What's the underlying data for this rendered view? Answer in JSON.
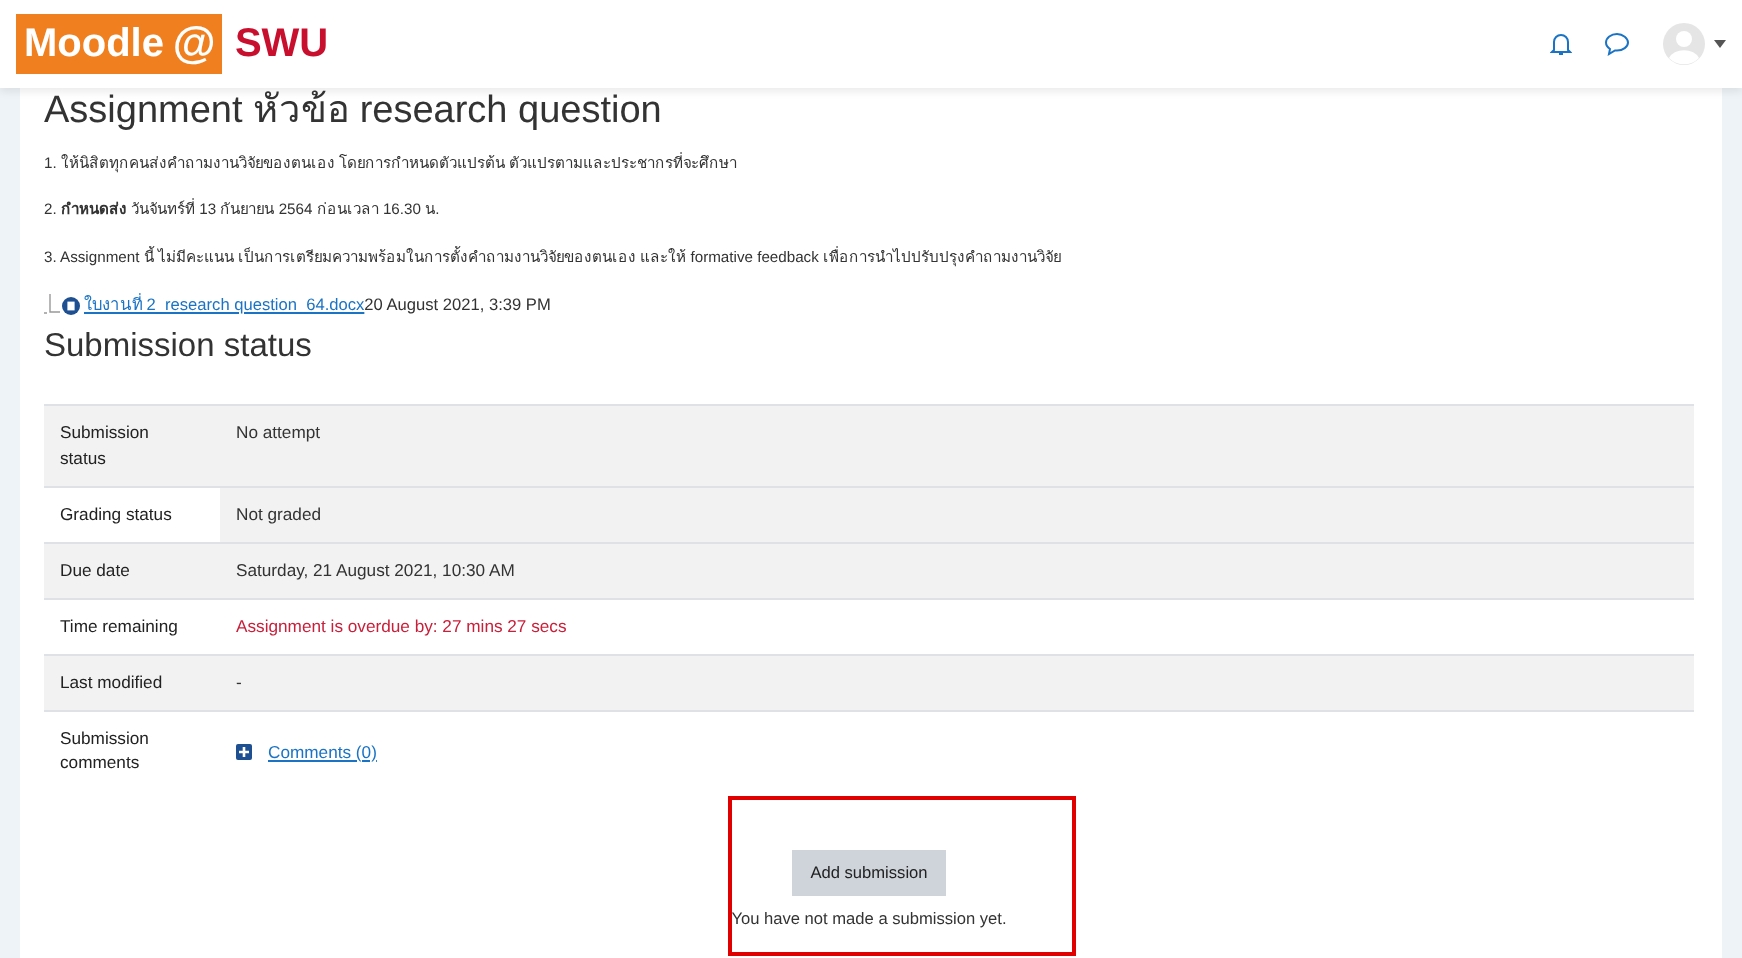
{
  "navbar": {
    "logo_left": "Moodle",
    "logo_at": "@",
    "logo_right": "SWU"
  },
  "title": "Assignment หัวข้อ research question",
  "instructions": [
    "1. ให้นิสิตทุกคนส่งคำถามงานวิจัยของตนเอง โดยการกำหนดตัวแปรต้น ตัวแปรตามและประชากรที่จะศึกษา",
    "2. **กำหนดส่ง** วันจันทร์ที่ 13 กันยายน 2564 ก่อนเวลา 16.30 น.",
    "3. Assignment นี้ ไม่มีคะแนน เป็นการเตรียมความพร้อมในการตั้งคำถามงานวิจัยของตนเอง และให้ formative feedback เพื่อการนำไปปรับปรุงคำถามงานวิจัย"
  ],
  "attachment": {
    "filename": "ใบงานที่ 2_research question_64.docx",
    "date": "20 August 2021, 3:39 PM"
  },
  "section_title": "Submission status",
  "status_rows": [
    {
      "label": "Submission status",
      "value": "No attempt",
      "kind": "text",
      "hovered": false
    },
    {
      "label": "Grading status",
      "value": "Not graded",
      "kind": "text",
      "hovered": true
    },
    {
      "label": "Due date",
      "value": "Saturday, 21 August 2021, 10:30 AM",
      "kind": "text",
      "hovered": false
    },
    {
      "label": "Time remaining",
      "value": "Assignment is overdue by: 27 mins 27 secs",
      "kind": "overdue",
      "hovered": false
    },
    {
      "label": "Last modified",
      "value": "-",
      "kind": "text",
      "hovered": false
    },
    {
      "label": "Submission comments",
      "value": "Comments (0)",
      "kind": "comments",
      "hovered": false
    }
  ],
  "add_button": "Add submission",
  "note": "You have not made a submission yet.",
  "highlight_frame": true
}
